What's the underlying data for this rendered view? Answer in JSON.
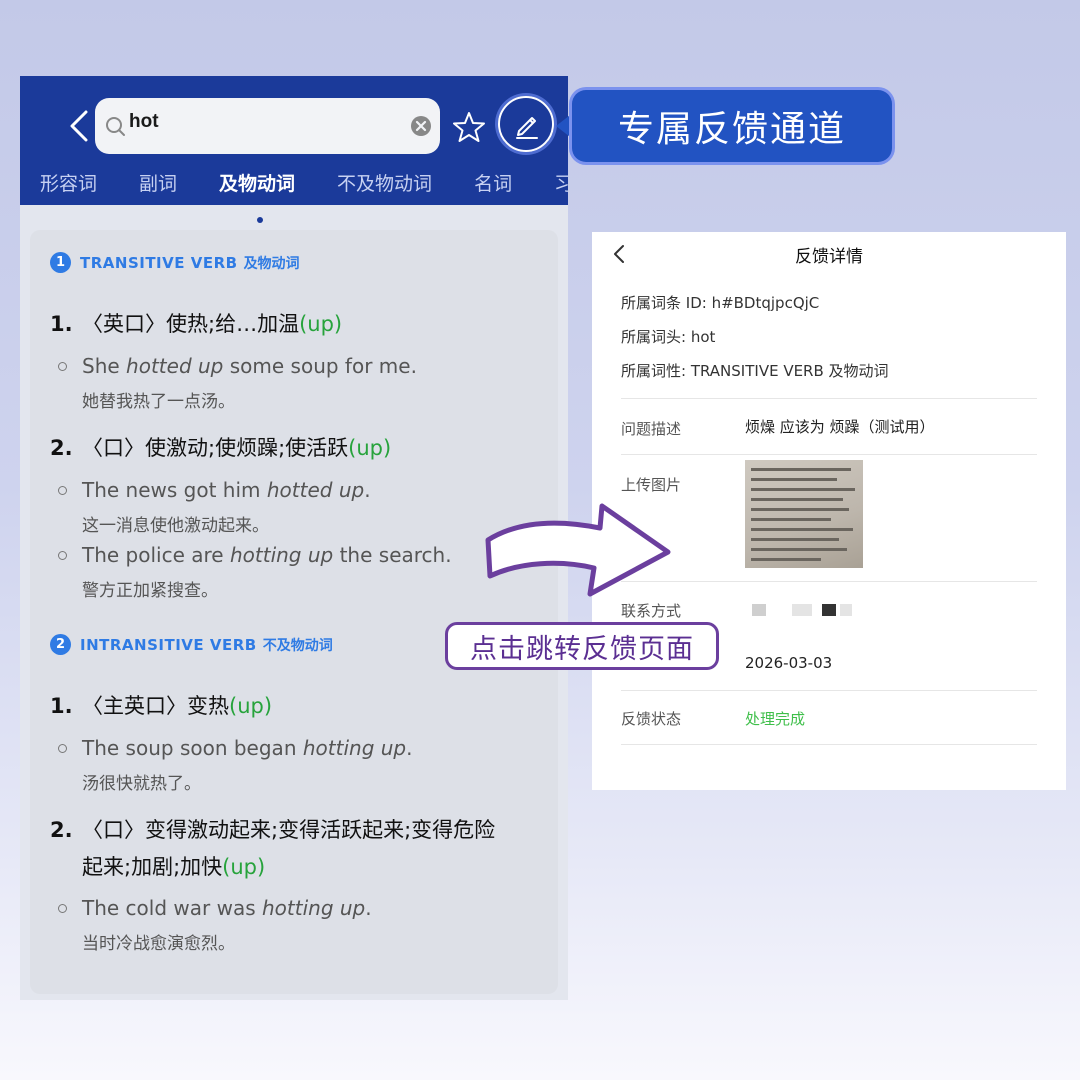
{
  "search": {
    "query": "hot"
  },
  "tabs": [
    "形容词",
    "副词",
    "及物动词",
    "不及物动词",
    "名词",
    "习"
  ],
  "callout": "专属反馈通道",
  "sections": [
    {
      "num": "1",
      "title": "TRANSITIVE VERB",
      "title_cn": "及物动词",
      "defs": [
        {
          "num": "1.",
          "text": "〈英口〉使热;给…加温",
          "up": "(up)",
          "examples": [
            {
              "en_pre": "She ",
              "en_it": "hotted up",
              "en_post": " some soup for me.",
              "cn": "她替我热了一点汤。"
            }
          ]
        },
        {
          "num": "2.",
          "text": "〈口〉使激动;使烦躁;使活跃",
          "up": "(up)",
          "examples": [
            {
              "en_pre": "The news got him ",
              "en_it": "hotted up",
              "en_post": ".",
              "cn": "这一消息使他激动起来。"
            },
            {
              "en_pre": "The police are ",
              "en_it": "hotting up",
              "en_post": " the search.",
              "cn": "警方正加紧搜查。"
            }
          ]
        }
      ]
    },
    {
      "num": "2",
      "title": "INTRANSITIVE VERB",
      "title_cn": "不及物动词",
      "defs": [
        {
          "num": "1.",
          "text": "〈主英口〉变热",
          "up": "(up)",
          "examples": [
            {
              "en_pre": "The soup soon began ",
              "en_it": "hotting up",
              "en_post": ".",
              "cn": "汤很快就热了。"
            }
          ]
        },
        {
          "num": "2.",
          "text": "〈口〉变得激动起来;变得活跃起来;变得危险",
          "text_line2": "起来;加剧;加快",
          "up": "(up)",
          "examples": [
            {
              "en_pre": "The cold war was ",
              "en_it": "hotting up",
              "en_post": ".",
              "cn": "当时冷战愈演愈烈。"
            }
          ]
        }
      ]
    }
  ],
  "feedback": {
    "title": "反馈详情",
    "entry_id": "所属词条 ID: h#BDtqjpcQjC",
    "headword": "所属词头: hot",
    "pos": "所属词性: TRANSITIVE VERB 及物动词",
    "desc_label": "问题描述",
    "desc_value": "烦燥 应该为 烦躁（测试用）",
    "image_label": "上传图片",
    "contact_label": "联系方式",
    "date_value": "2026-03-03",
    "status_label": "反馈状态",
    "status_value": "处理完成"
  },
  "link_label": "点击跳转反馈页面",
  "colors": {
    "header": "#1b3a9a",
    "accent": "#2f7be4",
    "up_green": "#27a33c",
    "status_green": "#3fbf4a",
    "purple": "#6b3f9e"
  }
}
